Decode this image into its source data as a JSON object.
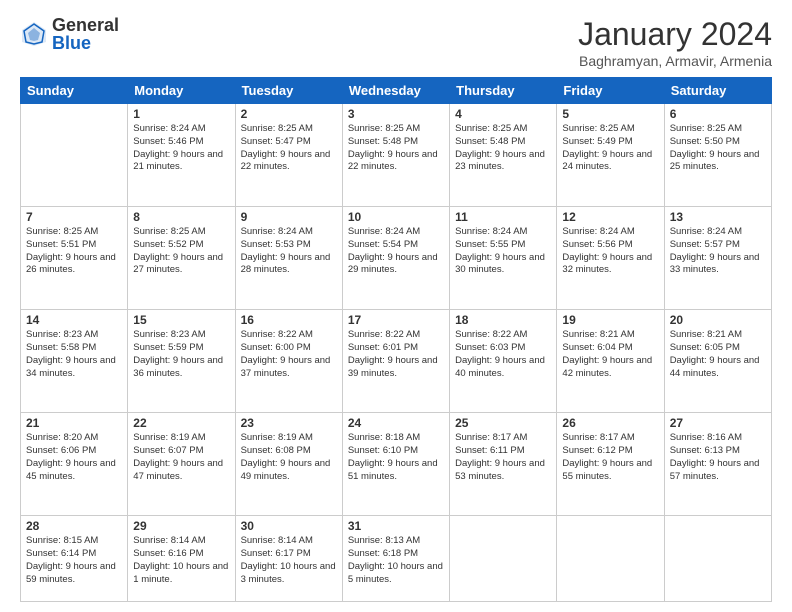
{
  "header": {
    "logo_general": "General",
    "logo_blue": "Blue",
    "month_title": "January 2024",
    "location": "Baghramyan, Armavir, Armenia"
  },
  "days_of_week": [
    "Sunday",
    "Monday",
    "Tuesday",
    "Wednesday",
    "Thursday",
    "Friday",
    "Saturday"
  ],
  "weeks": [
    [
      {
        "day": "",
        "sunrise": "",
        "sunset": "",
        "daylight": ""
      },
      {
        "day": "1",
        "sunrise": "Sunrise: 8:24 AM",
        "sunset": "Sunset: 5:46 PM",
        "daylight": "Daylight: 9 hours and 21 minutes."
      },
      {
        "day": "2",
        "sunrise": "Sunrise: 8:25 AM",
        "sunset": "Sunset: 5:47 PM",
        "daylight": "Daylight: 9 hours and 22 minutes."
      },
      {
        "day": "3",
        "sunrise": "Sunrise: 8:25 AM",
        "sunset": "Sunset: 5:48 PM",
        "daylight": "Daylight: 9 hours and 22 minutes."
      },
      {
        "day": "4",
        "sunrise": "Sunrise: 8:25 AM",
        "sunset": "Sunset: 5:48 PM",
        "daylight": "Daylight: 9 hours and 23 minutes."
      },
      {
        "day": "5",
        "sunrise": "Sunrise: 8:25 AM",
        "sunset": "Sunset: 5:49 PM",
        "daylight": "Daylight: 9 hours and 24 minutes."
      },
      {
        "day": "6",
        "sunrise": "Sunrise: 8:25 AM",
        "sunset": "Sunset: 5:50 PM",
        "daylight": "Daylight: 9 hours and 25 minutes."
      }
    ],
    [
      {
        "day": "7",
        "sunrise": "Sunrise: 8:25 AM",
        "sunset": "Sunset: 5:51 PM",
        "daylight": "Daylight: 9 hours and 26 minutes."
      },
      {
        "day": "8",
        "sunrise": "Sunrise: 8:25 AM",
        "sunset": "Sunset: 5:52 PM",
        "daylight": "Daylight: 9 hours and 27 minutes."
      },
      {
        "day": "9",
        "sunrise": "Sunrise: 8:24 AM",
        "sunset": "Sunset: 5:53 PM",
        "daylight": "Daylight: 9 hours and 28 minutes."
      },
      {
        "day": "10",
        "sunrise": "Sunrise: 8:24 AM",
        "sunset": "Sunset: 5:54 PM",
        "daylight": "Daylight: 9 hours and 29 minutes."
      },
      {
        "day": "11",
        "sunrise": "Sunrise: 8:24 AM",
        "sunset": "Sunset: 5:55 PM",
        "daylight": "Daylight: 9 hours and 30 minutes."
      },
      {
        "day": "12",
        "sunrise": "Sunrise: 8:24 AM",
        "sunset": "Sunset: 5:56 PM",
        "daylight": "Daylight: 9 hours and 32 minutes."
      },
      {
        "day": "13",
        "sunrise": "Sunrise: 8:24 AM",
        "sunset": "Sunset: 5:57 PM",
        "daylight": "Daylight: 9 hours and 33 minutes."
      }
    ],
    [
      {
        "day": "14",
        "sunrise": "Sunrise: 8:23 AM",
        "sunset": "Sunset: 5:58 PM",
        "daylight": "Daylight: 9 hours and 34 minutes."
      },
      {
        "day": "15",
        "sunrise": "Sunrise: 8:23 AM",
        "sunset": "Sunset: 5:59 PM",
        "daylight": "Daylight: 9 hours and 36 minutes."
      },
      {
        "day": "16",
        "sunrise": "Sunrise: 8:22 AM",
        "sunset": "Sunset: 6:00 PM",
        "daylight": "Daylight: 9 hours and 37 minutes."
      },
      {
        "day": "17",
        "sunrise": "Sunrise: 8:22 AM",
        "sunset": "Sunset: 6:01 PM",
        "daylight": "Daylight: 9 hours and 39 minutes."
      },
      {
        "day": "18",
        "sunrise": "Sunrise: 8:22 AM",
        "sunset": "Sunset: 6:03 PM",
        "daylight": "Daylight: 9 hours and 40 minutes."
      },
      {
        "day": "19",
        "sunrise": "Sunrise: 8:21 AM",
        "sunset": "Sunset: 6:04 PM",
        "daylight": "Daylight: 9 hours and 42 minutes."
      },
      {
        "day": "20",
        "sunrise": "Sunrise: 8:21 AM",
        "sunset": "Sunset: 6:05 PM",
        "daylight": "Daylight: 9 hours and 44 minutes."
      }
    ],
    [
      {
        "day": "21",
        "sunrise": "Sunrise: 8:20 AM",
        "sunset": "Sunset: 6:06 PM",
        "daylight": "Daylight: 9 hours and 45 minutes."
      },
      {
        "day": "22",
        "sunrise": "Sunrise: 8:19 AM",
        "sunset": "Sunset: 6:07 PM",
        "daylight": "Daylight: 9 hours and 47 minutes."
      },
      {
        "day": "23",
        "sunrise": "Sunrise: 8:19 AM",
        "sunset": "Sunset: 6:08 PM",
        "daylight": "Daylight: 9 hours and 49 minutes."
      },
      {
        "day": "24",
        "sunrise": "Sunrise: 8:18 AM",
        "sunset": "Sunset: 6:10 PM",
        "daylight": "Daylight: 9 hours and 51 minutes."
      },
      {
        "day": "25",
        "sunrise": "Sunrise: 8:17 AM",
        "sunset": "Sunset: 6:11 PM",
        "daylight": "Daylight: 9 hours and 53 minutes."
      },
      {
        "day": "26",
        "sunrise": "Sunrise: 8:17 AM",
        "sunset": "Sunset: 6:12 PM",
        "daylight": "Daylight: 9 hours and 55 minutes."
      },
      {
        "day": "27",
        "sunrise": "Sunrise: 8:16 AM",
        "sunset": "Sunset: 6:13 PM",
        "daylight": "Daylight: 9 hours and 57 minutes."
      }
    ],
    [
      {
        "day": "28",
        "sunrise": "Sunrise: 8:15 AM",
        "sunset": "Sunset: 6:14 PM",
        "daylight": "Daylight: 9 hours and 59 minutes."
      },
      {
        "day": "29",
        "sunrise": "Sunrise: 8:14 AM",
        "sunset": "Sunset: 6:16 PM",
        "daylight": "Daylight: 10 hours and 1 minute."
      },
      {
        "day": "30",
        "sunrise": "Sunrise: 8:14 AM",
        "sunset": "Sunset: 6:17 PM",
        "daylight": "Daylight: 10 hours and 3 minutes."
      },
      {
        "day": "31",
        "sunrise": "Sunrise: 8:13 AM",
        "sunset": "Sunset: 6:18 PM",
        "daylight": "Daylight: 10 hours and 5 minutes."
      },
      {
        "day": "",
        "sunrise": "",
        "sunset": "",
        "daylight": ""
      },
      {
        "day": "",
        "sunrise": "",
        "sunset": "",
        "daylight": ""
      },
      {
        "day": "",
        "sunrise": "",
        "sunset": "",
        "daylight": ""
      }
    ]
  ]
}
